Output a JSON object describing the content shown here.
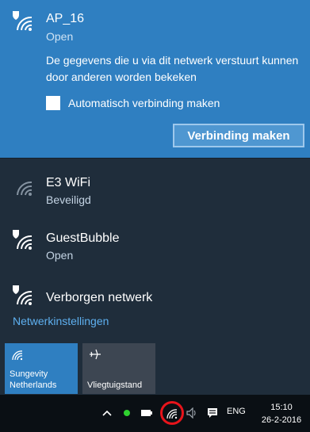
{
  "selected_network": {
    "name": "AP_16",
    "status": "Open",
    "warning": "De gegevens die u via dit netwerk verstuurt kunnen door anderen worden bekeken",
    "auto_connect_label": "Automatisch verbinding maken",
    "auto_connect_checked": false,
    "connect_label": "Verbinding maken"
  },
  "networks": [
    {
      "name": "E3 WiFi",
      "status": "Beveiligd",
      "icon": "wifi-secured-icon"
    },
    {
      "name": "GuestBubble",
      "status": "Open",
      "icon": "wifi-open-shield-icon"
    },
    {
      "name": "Verborgen netwerk",
      "status": "",
      "icon": "wifi-open-shield-icon"
    }
  ],
  "settings_link": "Netwerkinstellingen",
  "quick_actions": [
    {
      "label": "Sungevity Netherlands",
      "icon": "wifi-icon",
      "active": true
    },
    {
      "label": "Vliegtuigstand",
      "icon": "airplane-icon",
      "active": false
    }
  ],
  "taskbar": {
    "language": "ENG",
    "time": "15:10",
    "date": "26-2-2016"
  },
  "colors": {
    "accent": "#2f7fc1",
    "flyout_bg": "#1f2d3b",
    "link": "#5eb0f0",
    "highlight": "#e8141b"
  }
}
